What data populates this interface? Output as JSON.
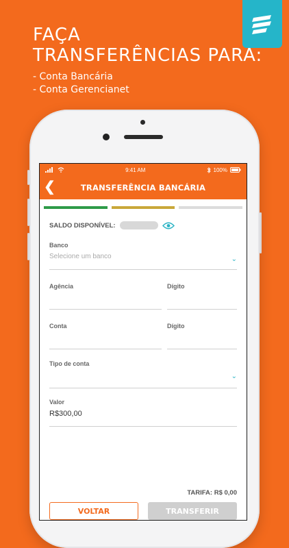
{
  "promo": {
    "title_line1": "FAÇA",
    "title_line2": "TRANSFERÊNCIAS PARA:",
    "list": [
      "- Conta Bancária",
      "- Conta Gerencianet"
    ]
  },
  "status_bar": {
    "time": "9:41 AM",
    "battery": "100%"
  },
  "header": {
    "title": "TRANSFERÊNCIA BANCÁRIA"
  },
  "progress": {
    "colors": [
      "#2e9b48",
      "#c9a83a",
      "#dcdcdc"
    ]
  },
  "saldo": {
    "label": "SALDO DISPONÍVEL:"
  },
  "form": {
    "banco_label": "Banco",
    "banco_placeholder": "Selecione um banco",
    "agencia_label": "Agência",
    "digito_agencia_label": "Dígito",
    "conta_label": "Conta",
    "digito_conta_label": "Dígito",
    "tipo_conta_label": "Tipo de conta",
    "valor_label": "Valor",
    "valor_value": "R$300,00"
  },
  "tarifa": "TARIFA: R$ 0,00",
  "buttons": {
    "voltar": "VOLTAR",
    "transferir": "TRANSFERIR"
  },
  "colors": {
    "brand_orange": "#f36a1d",
    "accent_teal": "#2ab3c4",
    "logo_bg": "#25b5c9"
  }
}
